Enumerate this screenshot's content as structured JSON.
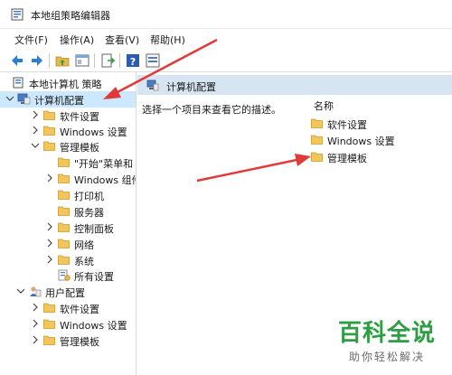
{
  "window": {
    "title": "本地组策略编辑器"
  },
  "menu": {
    "items": [
      "文件(F)",
      "操作(A)",
      "查看(V)",
      "帮助(H)"
    ]
  },
  "toolbar": {
    "icons": [
      "back-arrow-icon",
      "forward-arrow-icon",
      "folder-up-icon",
      "show-hide-tree-icon",
      "export-list-icon",
      "help-icon",
      "properties-icon"
    ]
  },
  "tree": {
    "root": "本地计算机 策略",
    "computer_config": "计算机配置",
    "computer_children": [
      "软件设置",
      "Windows 设置",
      "管理模板"
    ],
    "admin_templates_children": [
      "\"开始\"菜单和",
      "Windows 组件",
      "打印机",
      "服务器",
      "控制面板",
      "网络",
      "系统",
      "所有设置"
    ],
    "user_config": "用户配置",
    "user_children": [
      "软件设置",
      "Windows 设置",
      "管理模板"
    ]
  },
  "details": {
    "header_title": "计算机配置",
    "description": "选择一个项目来查看它的描述。",
    "column_name": "名称",
    "items": [
      "软件设置",
      "Windows 设置",
      "管理模板"
    ]
  },
  "watermark": {
    "main": "百科全说",
    "sub": "助你轻松解决"
  },
  "colors": {
    "selection": "#cce8ff",
    "header": "#d7e4f2",
    "folder": "#f2c65a",
    "arrow": "#e03a3a",
    "watermark": "#2e9d44"
  }
}
